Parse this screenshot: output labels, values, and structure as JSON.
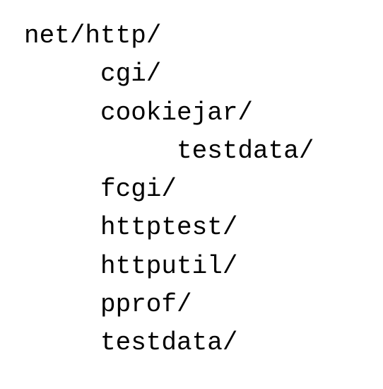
{
  "directory_tree": [
    {
      "label": "net/http/",
      "depth": 0
    },
    {
      "label": "cgi/",
      "depth": 1
    },
    {
      "label": "cookiejar/",
      "depth": 1
    },
    {
      "label": "testdata/",
      "depth": 2
    },
    {
      "label": "fcgi/",
      "depth": 1
    },
    {
      "label": "httptest/",
      "depth": 1
    },
    {
      "label": "httputil/",
      "depth": 1
    },
    {
      "label": "pprof/",
      "depth": 1
    },
    {
      "label": "testdata/",
      "depth": 1
    }
  ]
}
